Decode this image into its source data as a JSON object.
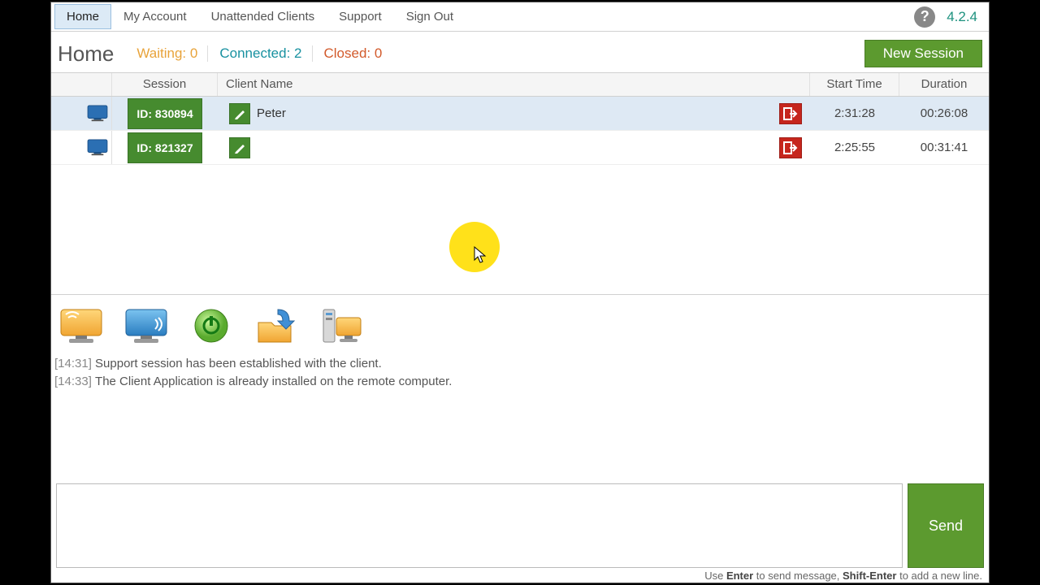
{
  "nav": {
    "items": [
      "Home",
      "My Account",
      "Unattended Clients",
      "Support",
      "Sign Out"
    ],
    "active_index": 0,
    "version": "4.2.4"
  },
  "header": {
    "title": "Home",
    "stats": {
      "waiting_label": "Waiting:",
      "waiting_value": "0",
      "connected_label": "Connected:",
      "connected_value": "2",
      "closed_label": "Closed:",
      "closed_value": "0"
    },
    "new_session": "New Session"
  },
  "table": {
    "headers": {
      "session": "Session",
      "client": "Client Name",
      "start": "Start Time",
      "duration": "Duration"
    },
    "rows": [
      {
        "id": "830894",
        "id_label": "ID: 830894",
        "client": "Peter",
        "start": "2:31:28",
        "duration": "00:26:08",
        "selected": true
      },
      {
        "id": "821327",
        "id_label": "ID: 821327",
        "client": "",
        "start": "2:25:55",
        "duration": "00:31:41",
        "selected": false
      }
    ]
  },
  "log": [
    {
      "time": "[14:31]",
      "text": "Support session has been established with the client."
    },
    {
      "time": "[14:33]",
      "text": "The Client Application is already installed on the remote computer."
    }
  ],
  "chat": {
    "placeholder": "",
    "send": "Send",
    "hint_pre": "Use ",
    "hint_enter": "Enter",
    "hint_mid": " to send message, ",
    "hint_shift": "Shift-Enter",
    "hint_post": " to add a new line."
  },
  "tool_icons": [
    "remote-view-icon",
    "remote-control-icon",
    "restart-icon",
    "file-transfer-icon",
    "system-info-icon"
  ]
}
